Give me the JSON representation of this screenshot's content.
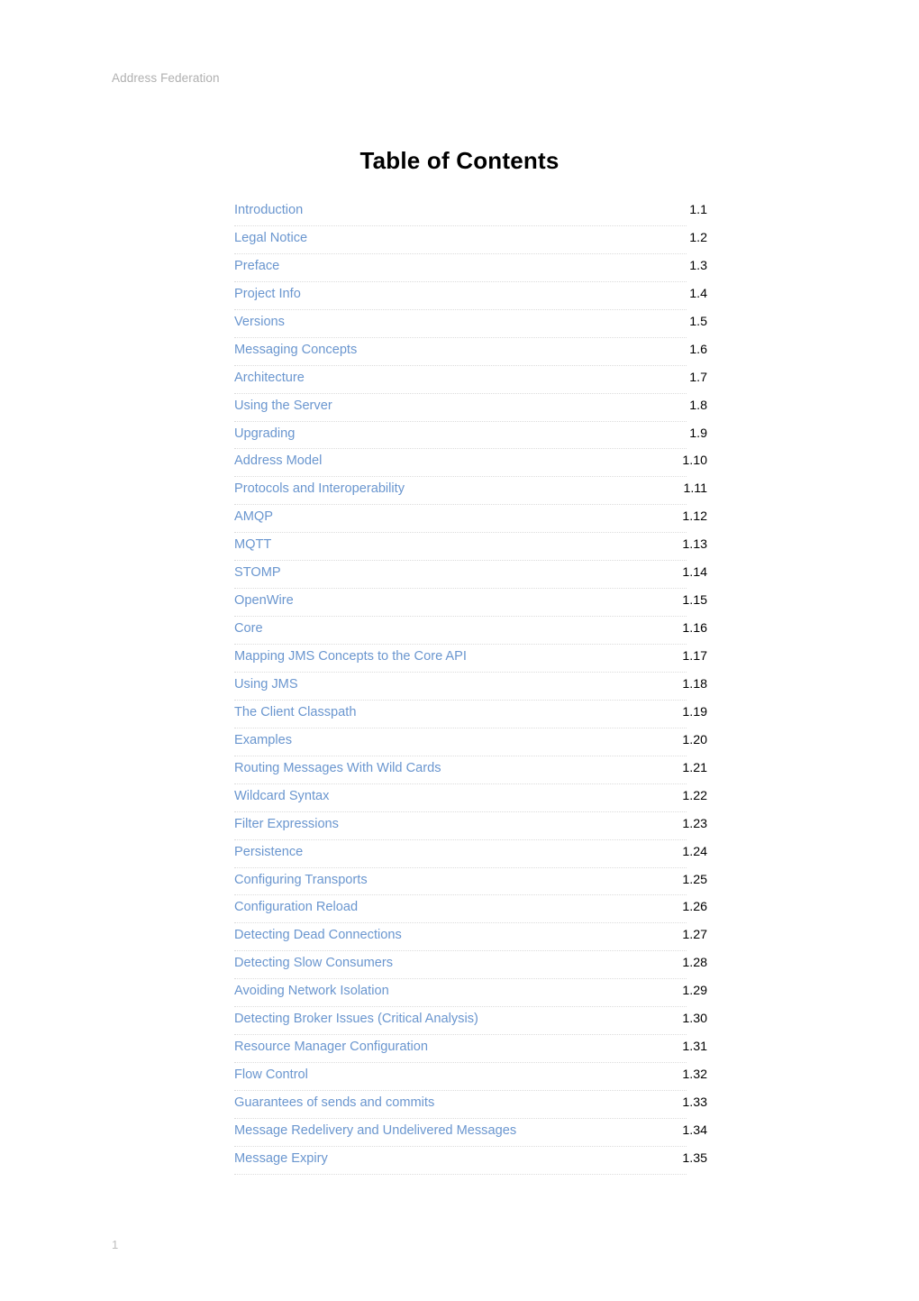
{
  "document": {
    "running_header": "Address Federation",
    "title": "Table of Contents",
    "footer_page_number": "1",
    "link_color": "#6a96cf",
    "header_color": "#b0b0b0",
    "rule_color": "#dcdcdc",
    "number_color": "#000000",
    "background_color": "#ffffff"
  },
  "toc": {
    "entries": [
      {
        "label": "Introduction",
        "number": "1.1"
      },
      {
        "label": "Legal Notice",
        "number": "1.2"
      },
      {
        "label": "Preface",
        "number": "1.3"
      },
      {
        "label": "Project Info",
        "number": "1.4"
      },
      {
        "label": "Versions",
        "number": "1.5"
      },
      {
        "label": "Messaging Concepts",
        "number": "1.6"
      },
      {
        "label": "Architecture",
        "number": "1.7"
      },
      {
        "label": "Using the Server",
        "number": "1.8"
      },
      {
        "label": "Upgrading",
        "number": "1.9"
      },
      {
        "label": "Address Model",
        "number": "1.10"
      },
      {
        "label": "Protocols and Interoperability",
        "number": "1.11"
      },
      {
        "label": "AMQP",
        "number": "1.12"
      },
      {
        "label": "MQTT",
        "number": "1.13"
      },
      {
        "label": "STOMP",
        "number": "1.14"
      },
      {
        "label": "OpenWire",
        "number": "1.15"
      },
      {
        "label": "Core",
        "number": "1.16"
      },
      {
        "label": "Mapping JMS Concepts to the Core API",
        "number": "1.17"
      },
      {
        "label": "Using JMS",
        "number": "1.18"
      },
      {
        "label": "The Client Classpath",
        "number": "1.19"
      },
      {
        "label": "Examples",
        "number": "1.20"
      },
      {
        "label": "Routing Messages With Wild Cards",
        "number": "1.21"
      },
      {
        "label": "Wildcard Syntax",
        "number": "1.22"
      },
      {
        "label": "Filter Expressions",
        "number": "1.23"
      },
      {
        "label": "Persistence",
        "number": "1.24"
      },
      {
        "label": "Configuring Transports",
        "number": "1.25"
      },
      {
        "label": "Configuration Reload",
        "number": "1.26"
      },
      {
        "label": "Detecting Dead Connections",
        "number": "1.27"
      },
      {
        "label": "Detecting Slow Consumers",
        "number": "1.28"
      },
      {
        "label": "Avoiding Network Isolation",
        "number": "1.29"
      },
      {
        "label": "Detecting Broker Issues (Critical Analysis)",
        "number": "1.30"
      },
      {
        "label": "Resource Manager Configuration",
        "number": "1.31"
      },
      {
        "label": "Flow Control",
        "number": "1.32"
      },
      {
        "label": "Guarantees of sends and commits",
        "number": "1.33"
      },
      {
        "label": "Message Redelivery and Undelivered Messages",
        "number": "1.34"
      },
      {
        "label": "Message Expiry",
        "number": "1.35"
      }
    ]
  }
}
